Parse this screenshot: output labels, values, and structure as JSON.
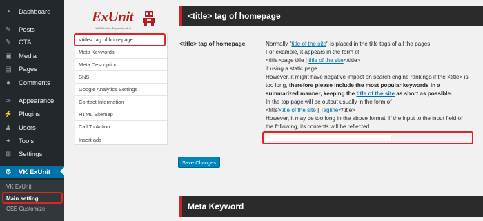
{
  "sidebar": {
    "items": [
      {
        "label": "Dashboard",
        "icon": "dashboard-icon"
      },
      {
        "label": "Posts",
        "icon": "pin-icon"
      },
      {
        "label": "CTA",
        "icon": "pin-icon"
      },
      {
        "label": "Media",
        "icon": "media-icon"
      },
      {
        "label": "Pages",
        "icon": "pages-icon"
      },
      {
        "label": "Comments",
        "icon": "comment-icon"
      },
      {
        "label": "Appearance",
        "icon": "brush-icon"
      },
      {
        "label": "Plugins",
        "icon": "plugin-icon"
      },
      {
        "label": "Users",
        "icon": "users-icon"
      },
      {
        "label": "Tools",
        "icon": "wrench-icon"
      },
      {
        "label": "Settings",
        "icon": "settings-icon"
      },
      {
        "label": "VK ExUnit",
        "icon": "gear-icon"
      }
    ],
    "submenu": [
      "VK ExUnit",
      "Main setting",
      "CSS Customize"
    ]
  },
  "logo": {
    "text": "ExUnit",
    "tagline": "VK All in One Expansion Unit"
  },
  "settings_nav": [
    "<title> tag of homepage",
    "Meta Keywords",
    "Meta Description",
    "SNS",
    "Google Analytics Settings",
    "Contact Information",
    "HTML Sitemap",
    "Call To Action",
    "Insert ads"
  ],
  "section": {
    "title": "<title> tag of homepage",
    "field_label": "<title> tag of homepage",
    "description": {
      "l1a": "Normally \"",
      "l1link": "title of the site",
      "l1b": "\" is placed in the title tags of all the pages.",
      "l2": "For example, it appears in the form of",
      "l3a": "<title>page title | ",
      "l3link": "title of the site",
      "l3b": "</title>",
      "l4": "if using a static page.",
      "l5": "However, it might have negative impact on search engine rankings if the <title> is",
      "l6a": "too long, ",
      "l6b": "therefore please include the most popular keywords in a",
      "l7a": "summarized manner, keeping the ",
      "l7link": "title of the site",
      "l7b": " as short as possible.",
      "l8": "In the top page will be output usually in the form of",
      "l9a": "<title>",
      "l9link1": "title of the site",
      "l9mid": " | ",
      "l9link2": "Tagline",
      "l9b": "</title>",
      "l10": "However, it may be too long in the above format. If the input to the input field of",
      "l11": "the following, its contents will be reflected."
    },
    "input_value": "",
    "save_label": "Save Changes"
  },
  "section2": {
    "title": "Meta Keyword"
  },
  "colors": {
    "sidebar_bg": "#23282d",
    "active": "#0073aa",
    "highlight": "#e02424",
    "header_bg": "#2b2b2b"
  }
}
